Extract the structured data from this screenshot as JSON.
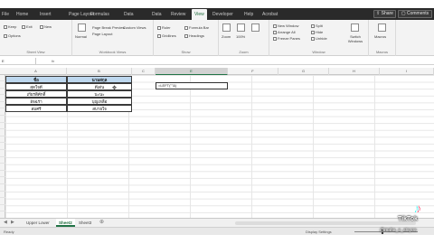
{
  "window": {
    "title": "Excel"
  },
  "ribbon_tabs": [
    {
      "label": "File"
    },
    {
      "label": "Home"
    },
    {
      "label": "Insert"
    },
    {
      "label": "Page Layout"
    },
    {
      "label": "Formulas"
    },
    {
      "label": "Data"
    },
    {
      "label": "Review"
    },
    {
      "label": "View"
    },
    {
      "label": "Developer"
    },
    {
      "label": "Help"
    },
    {
      "label": "Acrobat"
    }
  ],
  "active_tab": "View",
  "share_label": "Share",
  "comments_label": "Comments",
  "ribbon": {
    "groups": [
      {
        "name": "Sheet View",
        "buttons": [
          "Keep",
          "Exit",
          "New",
          "Options"
        ]
      },
      {
        "name": "Workbook Views",
        "buttons": [
          "Normal",
          "Page Break Preview",
          "Page Layout",
          "Custom Views"
        ]
      },
      {
        "name": "Show",
        "buttons": [
          "Ruler",
          "Formula Bar",
          "Gridlines",
          "Headings"
        ]
      },
      {
        "name": "Zoom",
        "buttons": [
          "Zoom",
          "100%",
          "Zoom to Selection"
        ]
      },
      {
        "name": "Window",
        "buttons": [
          "New Window",
          "Arrange All",
          "Freeze Panes",
          "Split",
          "Hide",
          "Unhide",
          "Switch Windows"
        ]
      },
      {
        "name": "Macros",
        "buttons": [
          "Macros"
        ]
      }
    ]
  },
  "formula_bar": {
    "name_box": "E",
    "fx": "fx"
  },
  "columns": [
    "A",
    "B",
    "C",
    "D",
    "E",
    "F",
    "G",
    "H",
    "I"
  ],
  "selected_column": "E",
  "table": {
    "headers": [
      "ชื่อ",
      "นามสกุล"
    ],
    "rows": [
      [
        "สุดใจดี",
        "ดีเด่น"
      ],
      [
        "เกียรติศักดิ์",
        "นะนะ"
      ],
      [
        "อัจฉรา",
        "บุญเหลือ"
      ],
      [
        "สมศรี",
        "สบายใจ"
      ]
    ]
  },
  "active_cell_value": "=LEFT(\"\"&)",
  "sheets": [
    "Upper Lower",
    "Sheet2",
    "Sheet3"
  ],
  "active_sheet": "Sheet2",
  "status": {
    "ready": "Ready",
    "display": "Display Settings"
  },
  "watermark": {
    "brand": "TikTok",
    "handle": "@maha_e_aiayoa"
  }
}
